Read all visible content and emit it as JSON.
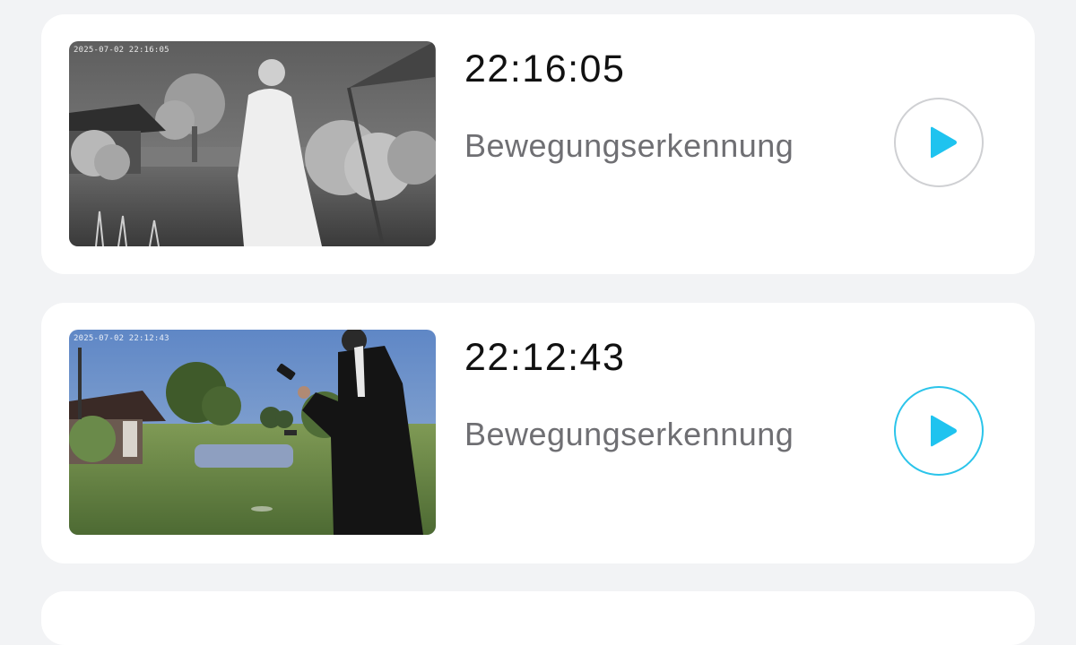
{
  "events": [
    {
      "time": "22:16:05",
      "label": "Bewegungserkennung",
      "thumbnail_timestamp": "2025-07-02 22:16:05",
      "thumbnail_mode": "night-vision",
      "play_icon": "play-icon",
      "play_ring_color": "#cfd0d3"
    },
    {
      "time": "22:12:43",
      "label": "Bewegungserkennung",
      "thumbnail_timestamp": "2025-07-02 22:12:43",
      "thumbnail_mode": "color",
      "play_icon": "play-icon",
      "play_ring_color": "#2bc4ea"
    }
  ],
  "colors": {
    "accent": "#1fc3ef",
    "background": "#f2f3f5",
    "card": "#ffffff",
    "time_text": "#111111",
    "label_text": "#6f6f73"
  }
}
